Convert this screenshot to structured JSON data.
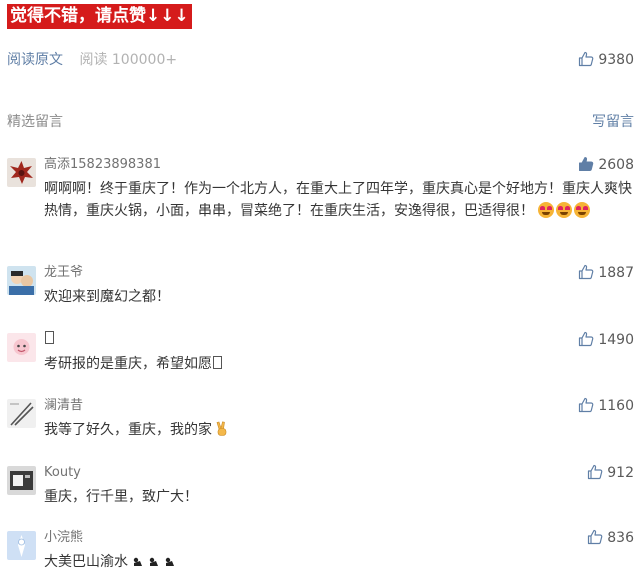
{
  "banner": {
    "text": "觉得不错，请点赞↓↓↓"
  },
  "meta": {
    "read_original": "阅读原文",
    "read_count": "阅读 100000+",
    "like_count": "9380"
  },
  "comments_header": {
    "title": "精选留言",
    "write": "写留言"
  },
  "comments": [
    {
      "nickname": "高添15823898381",
      "likes": "2608",
      "liked": true,
      "text": "啊啊啊！终于重庆了！作为一个北方人，在重大上了四年学，重庆真心是个好地方！重庆人爽快热情，重庆火锅，小面，串串，冒菜绝了！在重庆生活，安逸得很，巴适得很！"
    },
    {
      "nickname": "龙王爷",
      "likes": "1887",
      "liked": false,
      "text": "欢迎来到魔幻之都！"
    },
    {
      "nickname": "",
      "likes": "1490",
      "liked": false,
      "text": "考研报的是重庆，希望如愿"
    },
    {
      "nickname": "澜清昔",
      "likes": "1160",
      "liked": false,
      "text": "我等了好久，重庆，我的家"
    },
    {
      "nickname": "Kouty",
      "likes": "912",
      "liked": false,
      "text": "重庆，行千里，致广大！"
    },
    {
      "nickname": "小浣熊",
      "likes": "836",
      "liked": false,
      "text": "大美巴山渝水"
    }
  ],
  "colors": {
    "banner_bg": "#d51b1b",
    "link": "#607fa6",
    "liked": "#607fa6"
  }
}
